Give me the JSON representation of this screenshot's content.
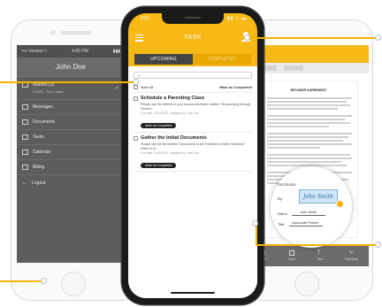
{
  "colors": {
    "accent": "#f7b917",
    "callout": "#f4b400",
    "drawer_bg": "#5d5d5d",
    "tab_active": "#444444"
  },
  "left_phone": {
    "drawer": {
      "status_left": "•••• Verizon  ≈",
      "status_time": "4:05 PM",
      "status_right": "▮▮▮",
      "user_name": "John Doe",
      "items": [
        {
          "icon": "briefcase-icon",
          "label": "Matters (3)",
          "sub": "2000S - Test matter"
        },
        {
          "icon": "chat-icon",
          "label": "Messages"
        },
        {
          "icon": "document-icon",
          "label": "Documents"
        },
        {
          "icon": "tasks-icon",
          "label": "Tasks"
        },
        {
          "icon": "calendar-icon",
          "label": "Calendar"
        },
        {
          "icon": "billing-icon",
          "label": "Billing"
        },
        {
          "icon": "logout-icon",
          "label": "Logout"
        }
      ]
    }
  },
  "center_phone": {
    "status_time": "9:41",
    "status_icons": "▮▮ ≈ ▬",
    "header": {
      "title": "TASK"
    },
    "tabs": {
      "upcoming": "UPCOMING",
      "completed": "COMPLETED"
    },
    "search_placeholder": "Q",
    "mark_all": "Mark All",
    "mark_completed": "Mark as Completed",
    "tasks": [
      {
        "title": "Schedule a Parenting Class",
        "desc": "Please use the referral in your documents folder entitled \"05 parenting through Divorce...",
        "meta": "Due date: 01/01/2019 · Assigned by: John Doe",
        "button": "Mark as Completed"
      },
      {
        "title": "Gather the Initial Documents",
        "desc": "Please use the list entitled \"Documents to be Provided to Better Solutions\" which is in...",
        "meta": "Due date: 01/05/2019 · Assigned by: John Doe",
        "button": "Mark as Completed"
      }
    ]
  },
  "right_phone": {
    "doc_title": "RETAINER AGREEMENT",
    "magnifier": {
      "label_received": "RECEIVED",
      "signature": "John Smith",
      "label_name": "Name:",
      "name_value": "John Smith",
      "label_title": "Title:",
      "title_value": "Associate Partner"
    },
    "tabbar": [
      {
        "icon": "draw-icon",
        "label": "Draw"
      },
      {
        "icon": "save-icon",
        "label": "Save"
      },
      {
        "icon": "text-icon",
        "label": "Text"
      },
      {
        "icon": "freehand-icon",
        "label": "Freehand"
      }
    ]
  }
}
